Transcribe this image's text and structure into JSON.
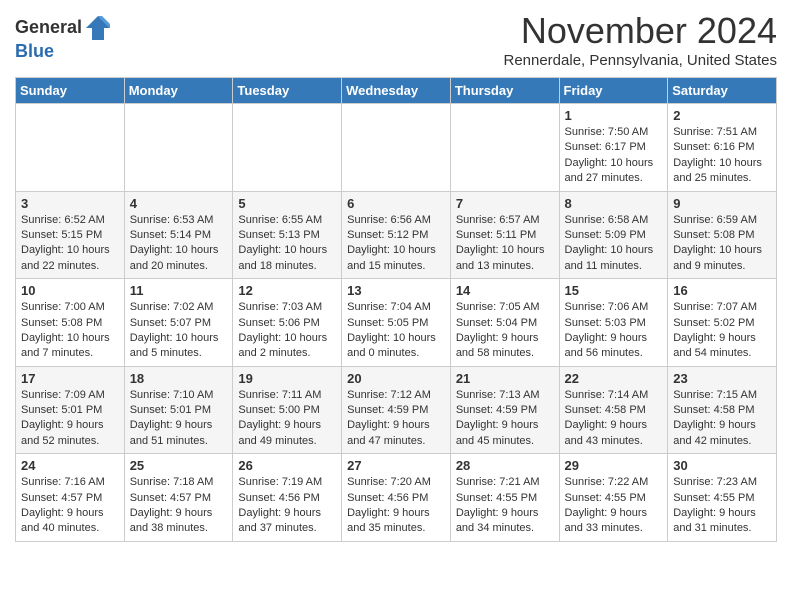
{
  "header": {
    "logo_line1": "General",
    "logo_line2": "Blue",
    "month_title": "November 2024",
    "location": "Rennerdale, Pennsylvania, United States"
  },
  "days_of_week": [
    "Sunday",
    "Monday",
    "Tuesday",
    "Wednesday",
    "Thursday",
    "Friday",
    "Saturday"
  ],
  "weeks": [
    [
      {
        "day": "",
        "info": ""
      },
      {
        "day": "",
        "info": ""
      },
      {
        "day": "",
        "info": ""
      },
      {
        "day": "",
        "info": ""
      },
      {
        "day": "",
        "info": ""
      },
      {
        "day": "1",
        "info": "Sunrise: 7:50 AM\nSunset: 6:17 PM\nDaylight: 10 hours and 27 minutes."
      },
      {
        "day": "2",
        "info": "Sunrise: 7:51 AM\nSunset: 6:16 PM\nDaylight: 10 hours and 25 minutes."
      }
    ],
    [
      {
        "day": "3",
        "info": "Sunrise: 6:52 AM\nSunset: 5:15 PM\nDaylight: 10 hours and 22 minutes."
      },
      {
        "day": "4",
        "info": "Sunrise: 6:53 AM\nSunset: 5:14 PM\nDaylight: 10 hours and 20 minutes."
      },
      {
        "day": "5",
        "info": "Sunrise: 6:55 AM\nSunset: 5:13 PM\nDaylight: 10 hours and 18 minutes."
      },
      {
        "day": "6",
        "info": "Sunrise: 6:56 AM\nSunset: 5:12 PM\nDaylight: 10 hours and 15 minutes."
      },
      {
        "day": "7",
        "info": "Sunrise: 6:57 AM\nSunset: 5:11 PM\nDaylight: 10 hours and 13 minutes."
      },
      {
        "day": "8",
        "info": "Sunrise: 6:58 AM\nSunset: 5:09 PM\nDaylight: 10 hours and 11 minutes."
      },
      {
        "day": "9",
        "info": "Sunrise: 6:59 AM\nSunset: 5:08 PM\nDaylight: 10 hours and 9 minutes."
      }
    ],
    [
      {
        "day": "10",
        "info": "Sunrise: 7:00 AM\nSunset: 5:08 PM\nDaylight: 10 hours and 7 minutes."
      },
      {
        "day": "11",
        "info": "Sunrise: 7:02 AM\nSunset: 5:07 PM\nDaylight: 10 hours and 5 minutes."
      },
      {
        "day": "12",
        "info": "Sunrise: 7:03 AM\nSunset: 5:06 PM\nDaylight: 10 hours and 2 minutes."
      },
      {
        "day": "13",
        "info": "Sunrise: 7:04 AM\nSunset: 5:05 PM\nDaylight: 10 hours and 0 minutes."
      },
      {
        "day": "14",
        "info": "Sunrise: 7:05 AM\nSunset: 5:04 PM\nDaylight: 9 hours and 58 minutes."
      },
      {
        "day": "15",
        "info": "Sunrise: 7:06 AM\nSunset: 5:03 PM\nDaylight: 9 hours and 56 minutes."
      },
      {
        "day": "16",
        "info": "Sunrise: 7:07 AM\nSunset: 5:02 PM\nDaylight: 9 hours and 54 minutes."
      }
    ],
    [
      {
        "day": "17",
        "info": "Sunrise: 7:09 AM\nSunset: 5:01 PM\nDaylight: 9 hours and 52 minutes."
      },
      {
        "day": "18",
        "info": "Sunrise: 7:10 AM\nSunset: 5:01 PM\nDaylight: 9 hours and 51 minutes."
      },
      {
        "day": "19",
        "info": "Sunrise: 7:11 AM\nSunset: 5:00 PM\nDaylight: 9 hours and 49 minutes."
      },
      {
        "day": "20",
        "info": "Sunrise: 7:12 AM\nSunset: 4:59 PM\nDaylight: 9 hours and 47 minutes."
      },
      {
        "day": "21",
        "info": "Sunrise: 7:13 AM\nSunset: 4:59 PM\nDaylight: 9 hours and 45 minutes."
      },
      {
        "day": "22",
        "info": "Sunrise: 7:14 AM\nSunset: 4:58 PM\nDaylight: 9 hours and 43 minutes."
      },
      {
        "day": "23",
        "info": "Sunrise: 7:15 AM\nSunset: 4:58 PM\nDaylight: 9 hours and 42 minutes."
      }
    ],
    [
      {
        "day": "24",
        "info": "Sunrise: 7:16 AM\nSunset: 4:57 PM\nDaylight: 9 hours and 40 minutes."
      },
      {
        "day": "25",
        "info": "Sunrise: 7:18 AM\nSunset: 4:57 PM\nDaylight: 9 hours and 38 minutes."
      },
      {
        "day": "26",
        "info": "Sunrise: 7:19 AM\nSunset: 4:56 PM\nDaylight: 9 hours and 37 minutes."
      },
      {
        "day": "27",
        "info": "Sunrise: 7:20 AM\nSunset: 4:56 PM\nDaylight: 9 hours and 35 minutes."
      },
      {
        "day": "28",
        "info": "Sunrise: 7:21 AM\nSunset: 4:55 PM\nDaylight: 9 hours and 34 minutes."
      },
      {
        "day": "29",
        "info": "Sunrise: 7:22 AM\nSunset: 4:55 PM\nDaylight: 9 hours and 33 minutes."
      },
      {
        "day": "30",
        "info": "Sunrise: 7:23 AM\nSunset: 4:55 PM\nDaylight: 9 hours and 31 minutes."
      }
    ]
  ]
}
